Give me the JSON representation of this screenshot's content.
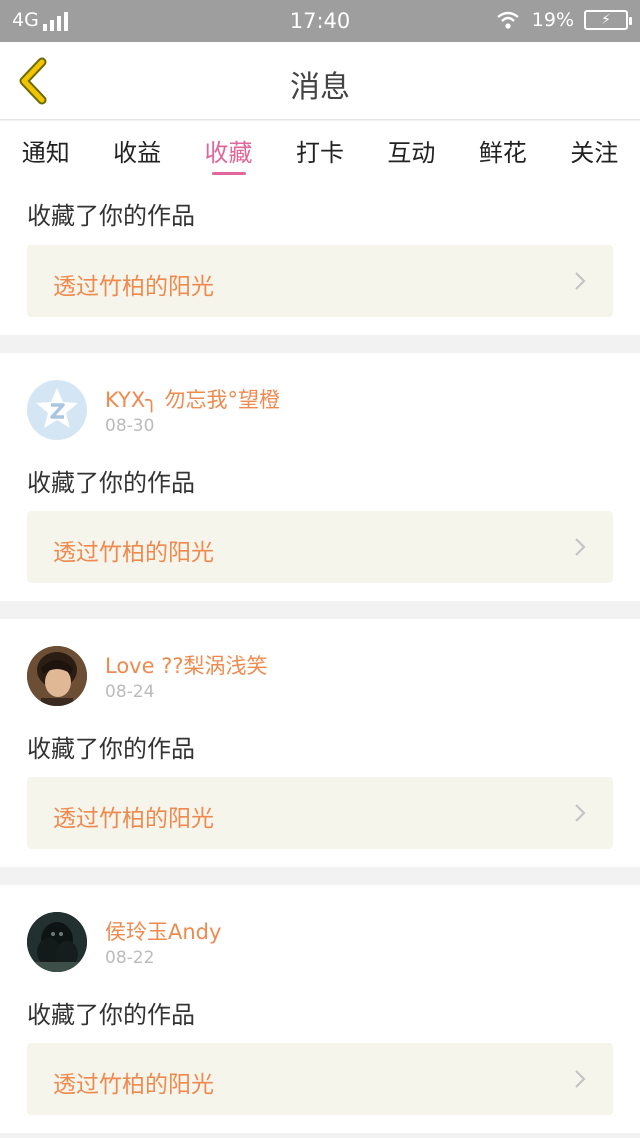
{
  "status": {
    "network": "4G",
    "time": "17:40",
    "battery": "19%"
  },
  "nav": {
    "title": "消息"
  },
  "tabs": [
    {
      "label": "通知"
    },
    {
      "label": "收益"
    },
    {
      "label": "收藏",
      "active": true
    },
    {
      "label": "打卡"
    },
    {
      "label": "互动"
    },
    {
      "label": "鲜花"
    },
    {
      "label": "关注"
    }
  ],
  "colors": {
    "accent": "#e0679a",
    "name": "#ef8a4f",
    "back": "#f2c400",
    "workBg": "#f5f5ec"
  },
  "items": [
    {
      "action": "收藏了你的作品",
      "work": "透过竹柏的阳光"
    },
    {
      "name": "KYX╮ 勿忘我°望橙",
      "date": "08-30",
      "action": "收藏了你的作品",
      "work": "透过竹柏的阳光",
      "avatar": "default-avatar"
    },
    {
      "name": "Love ??梨涡浅笑",
      "date": "08-24",
      "action": "收藏了你的作品",
      "work": "透过竹柏的阳光",
      "avatar": "photo-avatar"
    },
    {
      "name": "侯玲玉Andy",
      "date": "08-22",
      "action": "收藏了你的作品",
      "work": "透过竹柏的阳光",
      "avatar": "photo-avatar"
    }
  ]
}
